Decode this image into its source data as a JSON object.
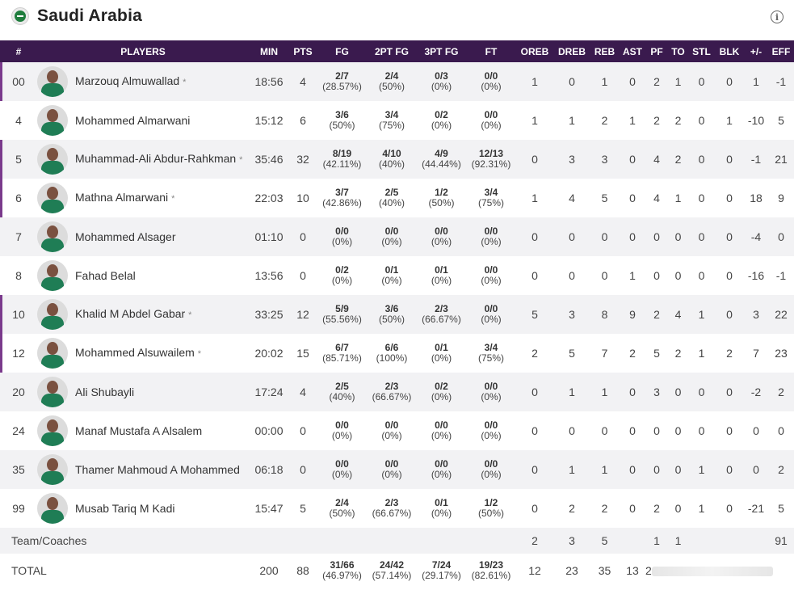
{
  "team": {
    "name": "Saudi Arabia"
  },
  "columns": [
    "#",
    "PLAYERS",
    "MIN",
    "PTS",
    "FG",
    "2PT FG",
    "3PT FG",
    "FT",
    "OREB",
    "DREB",
    "REB",
    "AST",
    "PF",
    "TO",
    "STL",
    "BLK",
    "+/-",
    "EFF"
  ],
  "players": [
    {
      "num": "00",
      "name": "Marzouq Almuwallad",
      "starter": true,
      "min": "18:56",
      "pts": "4",
      "fg": [
        "2/7",
        "(28.57%)"
      ],
      "fg2": [
        "2/4",
        "(50%)"
      ],
      "fg3": [
        "0/3",
        "(0%)"
      ],
      "ft": [
        "0/0",
        "(0%)"
      ],
      "oreb": "1",
      "dreb": "0",
      "reb": "1",
      "ast": "0",
      "pf": "2",
      "to": "1",
      "stl": "0",
      "blk": "0",
      "pm": "1",
      "eff": "-1"
    },
    {
      "num": "4",
      "name": "Mohammed Almarwani",
      "starter": false,
      "min": "15:12",
      "pts": "6",
      "fg": [
        "3/6",
        "(50%)"
      ],
      "fg2": [
        "3/4",
        "(75%)"
      ],
      "fg3": [
        "0/2",
        "(0%)"
      ],
      "ft": [
        "0/0",
        "(0%)"
      ],
      "oreb": "1",
      "dreb": "1",
      "reb": "2",
      "ast": "1",
      "pf": "2",
      "to": "2",
      "stl": "0",
      "blk": "1",
      "pm": "-10",
      "eff": "5"
    },
    {
      "num": "5",
      "name": "Muhammad-Ali Abdur-Rahkman",
      "starter": true,
      "min": "35:46",
      "pts": "32",
      "fg": [
        "8/19",
        "(42.11%)"
      ],
      "fg2": [
        "4/10",
        "(40%)"
      ],
      "fg3": [
        "4/9",
        "(44.44%)"
      ],
      "ft": [
        "12/13",
        "(92.31%)"
      ],
      "oreb": "0",
      "dreb": "3",
      "reb": "3",
      "ast": "0",
      "pf": "4",
      "to": "2",
      "stl": "0",
      "blk": "0",
      "pm": "-1",
      "eff": "21"
    },
    {
      "num": "6",
      "name": "Mathna Almarwani",
      "starter": true,
      "min": "22:03",
      "pts": "10",
      "fg": [
        "3/7",
        "(42.86%)"
      ],
      "fg2": [
        "2/5",
        "(40%)"
      ],
      "fg3": [
        "1/2",
        "(50%)"
      ],
      "ft": [
        "3/4",
        "(75%)"
      ],
      "oreb": "1",
      "dreb": "4",
      "reb": "5",
      "ast": "0",
      "pf": "4",
      "to": "1",
      "stl": "0",
      "blk": "0",
      "pm": "18",
      "eff": "9"
    },
    {
      "num": "7",
      "name": "Mohammed Alsager",
      "starter": false,
      "min": "01:10",
      "pts": "0",
      "fg": [
        "0/0",
        "(0%)"
      ],
      "fg2": [
        "0/0",
        "(0%)"
      ],
      "fg3": [
        "0/0",
        "(0%)"
      ],
      "ft": [
        "0/0",
        "(0%)"
      ],
      "oreb": "0",
      "dreb": "0",
      "reb": "0",
      "ast": "0",
      "pf": "0",
      "to": "0",
      "stl": "0",
      "blk": "0",
      "pm": "-4",
      "eff": "0"
    },
    {
      "num": "8",
      "name": "Fahad Belal",
      "starter": false,
      "min": "13:56",
      "pts": "0",
      "fg": [
        "0/2",
        "(0%)"
      ],
      "fg2": [
        "0/1",
        "(0%)"
      ],
      "fg3": [
        "0/1",
        "(0%)"
      ],
      "ft": [
        "0/0",
        "(0%)"
      ],
      "oreb": "0",
      "dreb": "0",
      "reb": "0",
      "ast": "1",
      "pf": "0",
      "to": "0",
      "stl": "0",
      "blk": "0",
      "pm": "-16",
      "eff": "-1"
    },
    {
      "num": "10",
      "name": "Khalid M Abdel Gabar",
      "starter": true,
      "min": "33:25",
      "pts": "12",
      "fg": [
        "5/9",
        "(55.56%)"
      ],
      "fg2": [
        "3/6",
        "(50%)"
      ],
      "fg3": [
        "2/3",
        "(66.67%)"
      ],
      "ft": [
        "0/0",
        "(0%)"
      ],
      "oreb": "5",
      "dreb": "3",
      "reb": "8",
      "ast": "9",
      "pf": "2",
      "to": "4",
      "stl": "1",
      "blk": "0",
      "pm": "3",
      "eff": "22"
    },
    {
      "num": "12",
      "name": "Mohammed Alsuwailem",
      "starter": true,
      "min": "20:02",
      "pts": "15",
      "fg": [
        "6/7",
        "(85.71%)"
      ],
      "fg2": [
        "6/6",
        "(100%)"
      ],
      "fg3": [
        "0/1",
        "(0%)"
      ],
      "ft": [
        "3/4",
        "(75%)"
      ],
      "oreb": "2",
      "dreb": "5",
      "reb": "7",
      "ast": "2",
      "pf": "5",
      "to": "2",
      "stl": "1",
      "blk": "2",
      "pm": "7",
      "eff": "23"
    },
    {
      "num": "20",
      "name": "Ali Shubayli",
      "starter": false,
      "min": "17:24",
      "pts": "4",
      "fg": [
        "2/5",
        "(40%)"
      ],
      "fg2": [
        "2/3",
        "(66.67%)"
      ],
      "fg3": [
        "0/2",
        "(0%)"
      ],
      "ft": [
        "0/0",
        "(0%)"
      ],
      "oreb": "0",
      "dreb": "1",
      "reb": "1",
      "ast": "0",
      "pf": "3",
      "to": "0",
      "stl": "0",
      "blk": "0",
      "pm": "-2",
      "eff": "2"
    },
    {
      "num": "24",
      "name": "Manaf Mustafa A Alsalem",
      "starter": false,
      "min": "00:00",
      "pts": "0",
      "fg": [
        "0/0",
        "(0%)"
      ],
      "fg2": [
        "0/0",
        "(0%)"
      ],
      "fg3": [
        "0/0",
        "(0%)"
      ],
      "ft": [
        "0/0",
        "(0%)"
      ],
      "oreb": "0",
      "dreb": "0",
      "reb": "0",
      "ast": "0",
      "pf": "0",
      "to": "0",
      "stl": "0",
      "blk": "0",
      "pm": "0",
      "eff": "0"
    },
    {
      "num": "35",
      "name": "Thamer Mahmoud A Mohammed",
      "starter": false,
      "min": "06:18",
      "pts": "0",
      "fg": [
        "0/0",
        "(0%)"
      ],
      "fg2": [
        "0/0",
        "(0%)"
      ],
      "fg3": [
        "0/0",
        "(0%)"
      ],
      "ft": [
        "0/0",
        "(0%)"
      ],
      "oreb": "0",
      "dreb": "1",
      "reb": "1",
      "ast": "0",
      "pf": "0",
      "to": "0",
      "stl": "1",
      "blk": "0",
      "pm": "0",
      "eff": "2"
    },
    {
      "num": "99",
      "name": "Musab Tariq M Kadi",
      "starter": false,
      "min": "15:47",
      "pts": "5",
      "fg": [
        "2/4",
        "(50%)"
      ],
      "fg2": [
        "2/3",
        "(66.67%)"
      ],
      "fg3": [
        "0/1",
        "(0%)"
      ],
      "ft": [
        "1/2",
        "(50%)"
      ],
      "oreb": "0",
      "dreb": "2",
      "reb": "2",
      "ast": "0",
      "pf": "2",
      "to": "0",
      "stl": "1",
      "blk": "0",
      "pm": "-21",
      "eff": "5"
    }
  ],
  "team_row": {
    "label": "Team/Coaches",
    "oreb": "2",
    "dreb": "3",
    "reb": "5",
    "pf": "1",
    "to": "1",
    "eff": "91"
  },
  "total_row": {
    "label": "TOTAL",
    "min": "200",
    "pts": "88",
    "fg": [
      "31/66",
      "(46.97%)"
    ],
    "fg2": [
      "24/42",
      "(57.14%)"
    ],
    "fg3": [
      "7/24",
      "(29.17%)"
    ],
    "ft": [
      "19/23",
      "(82.61%)"
    ],
    "oreb": "12",
    "dreb": "23",
    "reb": "35",
    "ast": "13",
    "pf_partial": "2"
  }
}
